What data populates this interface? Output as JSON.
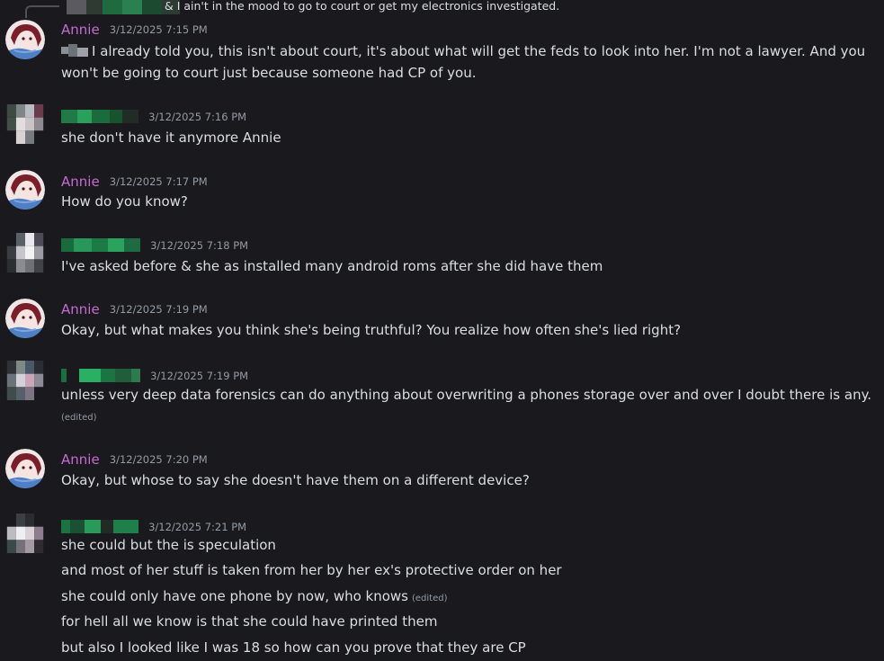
{
  "reply": {
    "text": "& I ain't in the mood to go to court or get my electronics investigated."
  },
  "colors": {
    "background": "#1a1a1e",
    "username_annie": "#c66bd3",
    "timestamp": "#949ba4",
    "message_text": "#dbdee1"
  },
  "messages": [
    {
      "author": "Annie",
      "timestamp": "3/12/2025 7:15 PM",
      "lines": [
        "I already told you, this isn't about court, it's about what will get the feds to look into her. I'm not a lawyer.  And you",
        "won't be going to court just because someone had CP of you."
      ]
    },
    {
      "author": "",
      "timestamp": "3/12/2025 7:16 PM",
      "lines": [
        "she don't have it anymore Annie"
      ]
    },
    {
      "author": "Annie",
      "timestamp": "3/12/2025 7:17 PM",
      "lines": [
        "How do you know?"
      ]
    },
    {
      "author": "",
      "timestamp": "3/12/2025 7:18 PM",
      "lines": [
        "I've asked before & she as installed many android roms after she did have them"
      ]
    },
    {
      "author": "Annie",
      "timestamp": "3/12/2025 7:19 PM",
      "lines": [
        "Okay, but what makes you think she's being truthful? You realize how often she's lied right?"
      ]
    },
    {
      "author": "",
      "timestamp": "3/12/2025 7:19 PM",
      "lines": [
        "unless very deep data forensics can do anything about overwriting a phones storage over and over I doubt there is any."
      ],
      "edited": "(edited)"
    },
    {
      "author": "Annie",
      "timestamp": "3/12/2025 7:20 PM",
      "lines": [
        "Okay, but whose to say she doesn't have them on a different device?"
      ]
    },
    {
      "author": "",
      "timestamp": "3/12/2025 7:21 PM",
      "lines": [
        "she could but the is speculation",
        "and most of her stuff is taken from her by her ex's protective order on her",
        "she could only have one phone by now, who knows",
        "for hell all we know is that she could have printed them",
        "but also I looked like I was 18 so how can you prove that they are CP"
      ],
      "line3_edited": "(edited)"
    }
  ]
}
